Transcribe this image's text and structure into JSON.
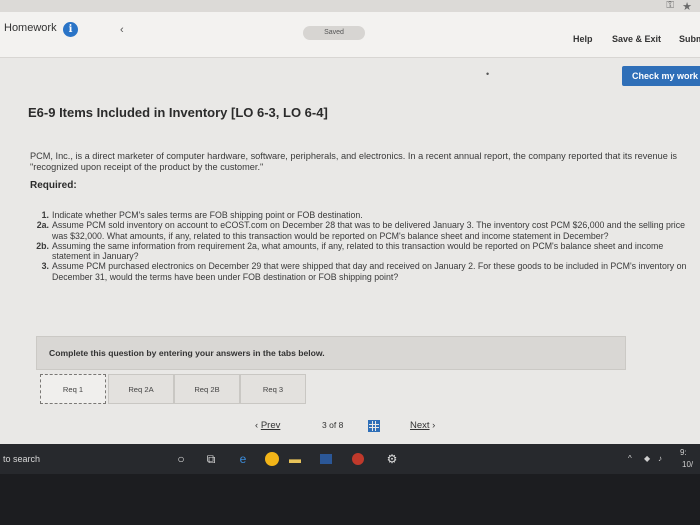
{
  "browser": {
    "key_icon": "key-icon",
    "star_icon": "star-icon"
  },
  "header": {
    "title": "Homework",
    "info_icon": "i",
    "saved": "Saved",
    "help": "Help",
    "save_exit": "Save & Exit",
    "submit": "Subm"
  },
  "toolbar": {
    "check_label": "Check my work"
  },
  "question": {
    "title": "E6-9 Items Included in Inventory [LO 6-3, LO 6-4]",
    "intro": "PCM, Inc., is a direct marketer of computer hardware, software, peripherals, and electronics. In a recent annual report, the company reported that its revenue is \"recognized upon receipt of the product by the customer.\"",
    "required_label": "Required:",
    "items": [
      {
        "num": "1.",
        "text": "Indicate whether PCM's sales terms are FOB shipping point or FOB destination."
      },
      {
        "num": "2a.",
        "text": "Assume PCM sold inventory on account to eCOST.com on December 28 that was to be delivered January 3. The inventory cost PCM $26,000 and the selling price was $32,000. What amounts, if any, related to this transaction would be reported on PCM's balance sheet and income statement in December?"
      },
      {
        "num": "2b.",
        "text": "Assuming the same information from requirement 2a, what amounts, if any, related to this transaction would be reported on PCM's balance sheet and income statement in January?"
      },
      {
        "num": "3.",
        "text": "Assume PCM purchased electronics on December 29 that were shipped that day and received on January 2. For these goods to be included in PCM's inventory on December 31, would the terms have been under FOB destination or FOB shipping point?"
      }
    ]
  },
  "complete_box": {
    "text": "Complete this question by entering your answers in the tabs below."
  },
  "tabs": [
    {
      "label": "Req 1",
      "active": true
    },
    {
      "label": "Req 2A",
      "active": false
    },
    {
      "label": "Req 2B",
      "active": false
    },
    {
      "label": "Req 3",
      "active": false
    }
  ],
  "pager": {
    "prev": "Prev",
    "page_current": "3",
    "page_of": "of",
    "page_total": "8",
    "next": "Next"
  },
  "taskbar": {
    "search": "to search",
    "icons": [
      "cortana-icon",
      "task-view-icon",
      "edge-icon",
      "chrome-icon",
      "file-explorer-icon",
      "word-icon",
      "powerpoint-icon",
      "settings-icon"
    ],
    "tray_time": "9:",
    "tray_date": "10/"
  }
}
